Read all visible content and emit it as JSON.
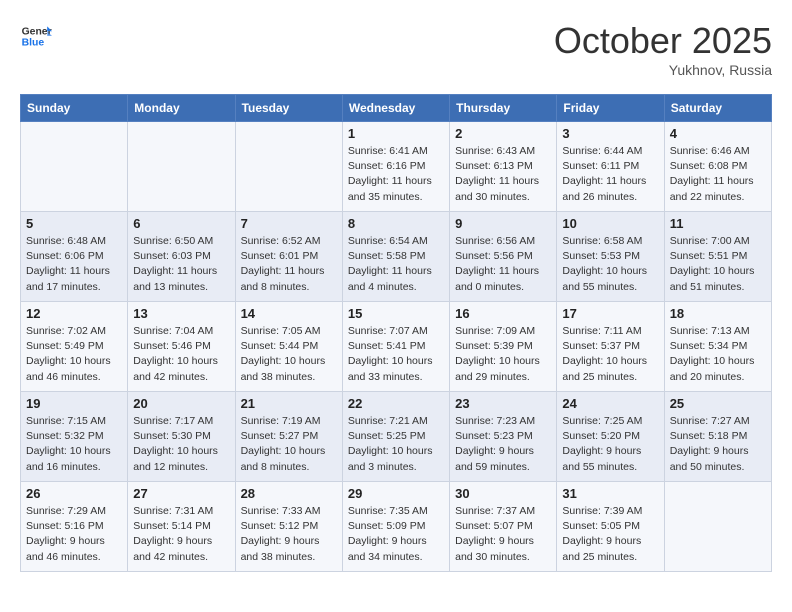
{
  "header": {
    "logo_general": "General",
    "logo_blue": "Blue",
    "month": "October 2025",
    "location": "Yukhnov, Russia"
  },
  "weekdays": [
    "Sunday",
    "Monday",
    "Tuesday",
    "Wednesday",
    "Thursday",
    "Friday",
    "Saturday"
  ],
  "weeks": [
    [
      {
        "day": "",
        "info": ""
      },
      {
        "day": "",
        "info": ""
      },
      {
        "day": "",
        "info": ""
      },
      {
        "day": "1",
        "info": "Sunrise: 6:41 AM\nSunset: 6:16 PM\nDaylight: 11 hours\nand 35 minutes."
      },
      {
        "day": "2",
        "info": "Sunrise: 6:43 AM\nSunset: 6:13 PM\nDaylight: 11 hours\nand 30 minutes."
      },
      {
        "day": "3",
        "info": "Sunrise: 6:44 AM\nSunset: 6:11 PM\nDaylight: 11 hours\nand 26 minutes."
      },
      {
        "day": "4",
        "info": "Sunrise: 6:46 AM\nSunset: 6:08 PM\nDaylight: 11 hours\nand 22 minutes."
      }
    ],
    [
      {
        "day": "5",
        "info": "Sunrise: 6:48 AM\nSunset: 6:06 PM\nDaylight: 11 hours\nand 17 minutes."
      },
      {
        "day": "6",
        "info": "Sunrise: 6:50 AM\nSunset: 6:03 PM\nDaylight: 11 hours\nand 13 minutes."
      },
      {
        "day": "7",
        "info": "Sunrise: 6:52 AM\nSunset: 6:01 PM\nDaylight: 11 hours\nand 8 minutes."
      },
      {
        "day": "8",
        "info": "Sunrise: 6:54 AM\nSunset: 5:58 PM\nDaylight: 11 hours\nand 4 minutes."
      },
      {
        "day": "9",
        "info": "Sunrise: 6:56 AM\nSunset: 5:56 PM\nDaylight: 11 hours\nand 0 minutes."
      },
      {
        "day": "10",
        "info": "Sunrise: 6:58 AM\nSunset: 5:53 PM\nDaylight: 10 hours\nand 55 minutes."
      },
      {
        "day": "11",
        "info": "Sunrise: 7:00 AM\nSunset: 5:51 PM\nDaylight: 10 hours\nand 51 minutes."
      }
    ],
    [
      {
        "day": "12",
        "info": "Sunrise: 7:02 AM\nSunset: 5:49 PM\nDaylight: 10 hours\nand 46 minutes."
      },
      {
        "day": "13",
        "info": "Sunrise: 7:04 AM\nSunset: 5:46 PM\nDaylight: 10 hours\nand 42 minutes."
      },
      {
        "day": "14",
        "info": "Sunrise: 7:05 AM\nSunset: 5:44 PM\nDaylight: 10 hours\nand 38 minutes."
      },
      {
        "day": "15",
        "info": "Sunrise: 7:07 AM\nSunset: 5:41 PM\nDaylight: 10 hours\nand 33 minutes."
      },
      {
        "day": "16",
        "info": "Sunrise: 7:09 AM\nSunset: 5:39 PM\nDaylight: 10 hours\nand 29 minutes."
      },
      {
        "day": "17",
        "info": "Sunrise: 7:11 AM\nSunset: 5:37 PM\nDaylight: 10 hours\nand 25 minutes."
      },
      {
        "day": "18",
        "info": "Sunrise: 7:13 AM\nSunset: 5:34 PM\nDaylight: 10 hours\nand 20 minutes."
      }
    ],
    [
      {
        "day": "19",
        "info": "Sunrise: 7:15 AM\nSunset: 5:32 PM\nDaylight: 10 hours\nand 16 minutes."
      },
      {
        "day": "20",
        "info": "Sunrise: 7:17 AM\nSunset: 5:30 PM\nDaylight: 10 hours\nand 12 minutes."
      },
      {
        "day": "21",
        "info": "Sunrise: 7:19 AM\nSunset: 5:27 PM\nDaylight: 10 hours\nand 8 minutes."
      },
      {
        "day": "22",
        "info": "Sunrise: 7:21 AM\nSunset: 5:25 PM\nDaylight: 10 hours\nand 3 minutes."
      },
      {
        "day": "23",
        "info": "Sunrise: 7:23 AM\nSunset: 5:23 PM\nDaylight: 9 hours\nand 59 minutes."
      },
      {
        "day": "24",
        "info": "Sunrise: 7:25 AM\nSunset: 5:20 PM\nDaylight: 9 hours\nand 55 minutes."
      },
      {
        "day": "25",
        "info": "Sunrise: 7:27 AM\nSunset: 5:18 PM\nDaylight: 9 hours\nand 50 minutes."
      }
    ],
    [
      {
        "day": "26",
        "info": "Sunrise: 7:29 AM\nSunset: 5:16 PM\nDaylight: 9 hours\nand 46 minutes."
      },
      {
        "day": "27",
        "info": "Sunrise: 7:31 AM\nSunset: 5:14 PM\nDaylight: 9 hours\nand 42 minutes."
      },
      {
        "day": "28",
        "info": "Sunrise: 7:33 AM\nSunset: 5:12 PM\nDaylight: 9 hours\nand 38 minutes."
      },
      {
        "day": "29",
        "info": "Sunrise: 7:35 AM\nSunset: 5:09 PM\nDaylight: 9 hours\nand 34 minutes."
      },
      {
        "day": "30",
        "info": "Sunrise: 7:37 AM\nSunset: 5:07 PM\nDaylight: 9 hours\nand 30 minutes."
      },
      {
        "day": "31",
        "info": "Sunrise: 7:39 AM\nSunset: 5:05 PM\nDaylight: 9 hours\nand 25 minutes."
      },
      {
        "day": "",
        "info": ""
      }
    ]
  ]
}
